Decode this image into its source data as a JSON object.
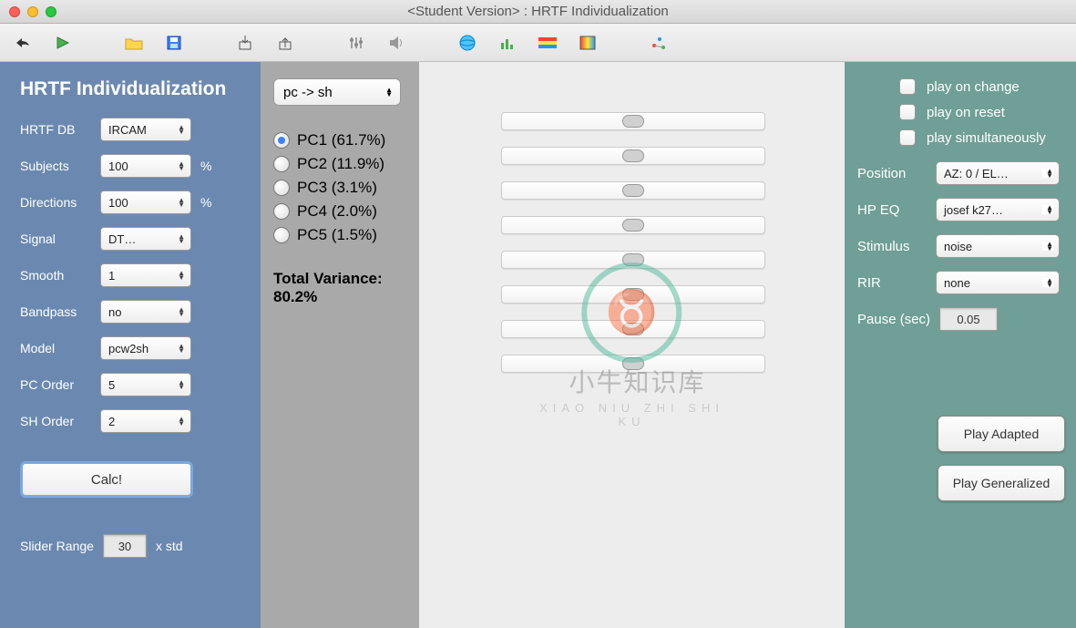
{
  "window": {
    "title": "<Student Version> : HRTF Individualization"
  },
  "left": {
    "heading": "HRTF Individualization",
    "fields": {
      "hrtf_db": {
        "label": "HRTF DB",
        "value": "IRCAM"
      },
      "subjects": {
        "label": "Subjects",
        "value": "100",
        "unit": "%"
      },
      "directions": {
        "label": "Directions",
        "value": "100",
        "unit": "%"
      },
      "signal": {
        "label": "Signal",
        "value": "DT…"
      },
      "smooth": {
        "label": "Smooth",
        "value": "1"
      },
      "bandpass": {
        "label": "Bandpass",
        "value": "no"
      },
      "model": {
        "label": "Model",
        "value": "pcw2sh"
      },
      "pc_order": {
        "label": "PC Order",
        "value": "5"
      },
      "sh_order": {
        "label": "SH Order",
        "value": "2"
      }
    },
    "calc_label": "Calc!",
    "slider_range": {
      "label": "Slider Range",
      "value": "30",
      "unit": "x std"
    }
  },
  "pc_panel": {
    "mode": "pc -> sh",
    "items": [
      {
        "label": "PC1 (61.7%)",
        "checked": true
      },
      {
        "label": "PC2 (11.9%)",
        "checked": false
      },
      {
        "label": "PC3 (3.1%)",
        "checked": false
      },
      {
        "label": "PC4 (2.0%)",
        "checked": false
      },
      {
        "label": "PC5 (1.5%)",
        "checked": false
      }
    ],
    "variance_label": "Total Variance:",
    "variance_value": "80.2%"
  },
  "right": {
    "checks": {
      "play_on_change": "play on change",
      "play_on_reset": "play on reset",
      "play_simultaneously": "play simultaneously"
    },
    "fields": {
      "position": {
        "label": "Position",
        "value": "AZ: 0 / EL…"
      },
      "hp_eq": {
        "label": "HP EQ",
        "value": "josef k27…"
      },
      "stimulus": {
        "label": "Stimulus",
        "value": "noise"
      },
      "rir": {
        "label": "RIR",
        "value": "none"
      },
      "pause": {
        "label": "Pause (sec)",
        "value": "0.05"
      }
    },
    "play_adapted": "Play Adapted",
    "play_generalized": "Play Generalized"
  },
  "watermark": {
    "cn": "小牛知识库",
    "en": "XIAO NIU ZHI SHI KU"
  }
}
